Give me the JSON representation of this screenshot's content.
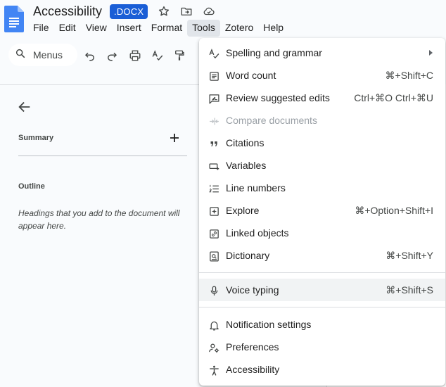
{
  "document": {
    "title": "Accessibility",
    "badge": ".DOCX"
  },
  "menubar": [
    "File",
    "Edit",
    "View",
    "Insert",
    "Format",
    "Tools",
    "Zotero",
    "Help"
  ],
  "menubar_active": "Tools",
  "toolbar": {
    "search_label": "Menus"
  },
  "panel": {
    "summary_label": "Summary",
    "outline_label": "Outline",
    "outline_hint": "Headings that you add to the document will appear here."
  },
  "tools_menu": {
    "spelling": "Spelling and grammar",
    "word_count": "Word count",
    "word_count_sc": "⌘+Shift+C",
    "review": "Review suggested edits",
    "review_sc": "Ctrl+⌘O Ctrl+⌘U",
    "compare": "Compare documents",
    "citations": "Citations",
    "variables": "Variables",
    "line_numbers": "Line numbers",
    "explore": "Explore",
    "explore_sc": "⌘+Option+Shift+I",
    "linked": "Linked objects",
    "dictionary": "Dictionary",
    "dictionary_sc": "⌘+Shift+Y",
    "voice": "Voice typing",
    "voice_sc": "⌘+Shift+S",
    "notifications": "Notification settings",
    "preferences": "Preferences",
    "accessibility": "Accessibility"
  },
  "colors": {
    "brand_blue": "#4285f4",
    "badge_blue": "#1a5ed6",
    "hover_gray": "#f1f3f4"
  }
}
